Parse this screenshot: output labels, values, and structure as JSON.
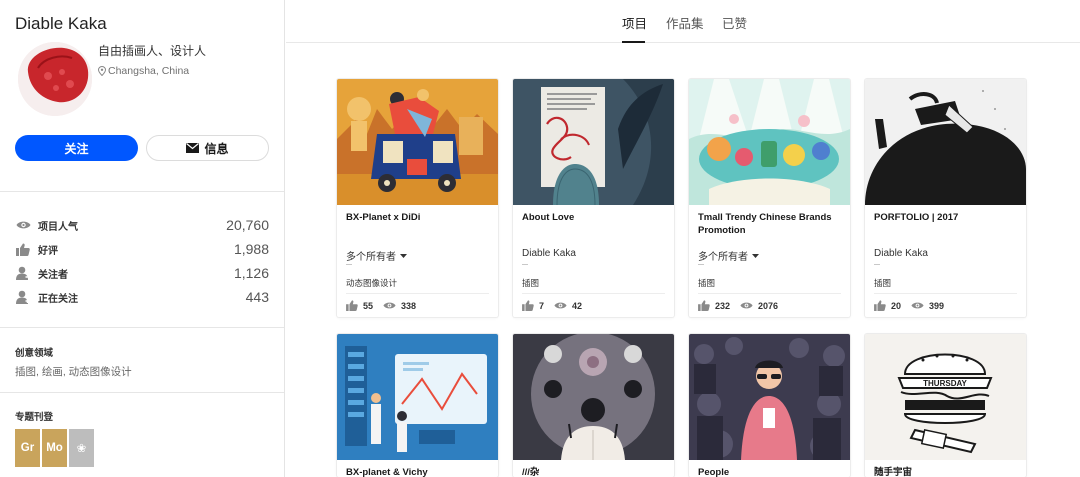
{
  "profile": {
    "name": "Diable Kaka",
    "occupation": "自由插画人、设计人",
    "location": "Changsha, China",
    "follow_label": "关注",
    "message_label": "信息"
  },
  "stats": [
    {
      "icon": "eye-icon",
      "label": "项目人气",
      "value": "20,760"
    },
    {
      "icon": "thumbs-up-icon",
      "label": "好评",
      "value": "1,988"
    },
    {
      "icon": "followers-icon",
      "label": "关注者",
      "value": "1,126"
    },
    {
      "icon": "following-icon",
      "label": "正在关注",
      "value": "443"
    }
  ],
  "creative_fields": {
    "title": "创意领域",
    "text": "插图, 绘画, 动态图像设计"
  },
  "features": {
    "title": "专题刊登",
    "badges": [
      "Gr",
      "Mo",
      "❀"
    ]
  },
  "tabs": [
    "项目",
    "作品集",
    "已赞"
  ],
  "active_tab": "项目",
  "projects": [
    {
      "title": "BX-Planet x DiDi",
      "owner": "多个所有者",
      "field": "动态图像设计",
      "likes": "55",
      "views": "338"
    },
    {
      "title": "About Love",
      "owner": "Diable Kaka",
      "field": "插图",
      "likes": "7",
      "views": "42"
    },
    {
      "title": "Tmall Trendy Chinese Brands Promotion",
      "owner": "多个所有者",
      "field": "插图",
      "likes": "232",
      "views": "2076"
    },
    {
      "title": "PORFTOLIO | 2017",
      "owner": "Diable Kaka",
      "field": "插图",
      "likes": "20",
      "views": "399"
    },
    {
      "title": "BX-planet & Vichy",
      "owner": "",
      "field": "",
      "likes": "",
      "views": ""
    },
    {
      "title": "///杂",
      "owner": "",
      "field": "",
      "likes": "",
      "views": ""
    },
    {
      "title": "People",
      "owner": "",
      "field": "",
      "likes": "",
      "views": ""
    },
    {
      "title": "随手宇宙",
      "owner": "",
      "field": "",
      "likes": "",
      "views": ""
    }
  ],
  "thumb_art": {
    "title": "THURSDAY"
  },
  "colors": {
    "accent": "#0057ff",
    "badge_gold": "#c9a45c",
    "badge_grey": "#bdbdbd"
  }
}
